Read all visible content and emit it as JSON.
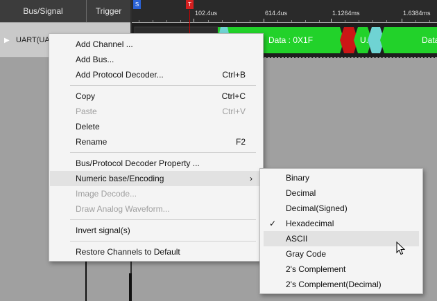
{
  "header": {
    "bus_signal": "Bus/Signal",
    "trigger": "Trigger",
    "ticks": [
      "102.4us",
      "614.4us",
      "1.1264ms",
      "1.6384ms"
    ],
    "marker_s": "S",
    "marker_t": "T"
  },
  "channel": {
    "name": "UART(UA",
    "frames": [
      "Data : 0X1F",
      "U.",
      "Data"
    ]
  },
  "colors": {
    "frame_green": "#22d22a",
    "frame_red": "#cc1616",
    "frame_cyan": "#6fd3d3",
    "menu_highlight": "#e2e2e2"
  },
  "context_menu": {
    "items": [
      {
        "label": "Add Channel ...",
        "shortcut": "",
        "disabled": false
      },
      {
        "label": "Add Bus...",
        "shortcut": "",
        "disabled": false
      },
      {
        "label": "Add Protocol Decoder...",
        "shortcut": "Ctrl+B",
        "disabled": false
      },
      {
        "label": "Copy",
        "shortcut": "Ctrl+C",
        "disabled": false
      },
      {
        "label": "Paste",
        "shortcut": "Ctrl+V",
        "disabled": true
      },
      {
        "label": "Delete",
        "shortcut": "",
        "disabled": false
      },
      {
        "label": "Rename",
        "shortcut": "F2",
        "disabled": false
      },
      {
        "label": "Bus/Protocol Decoder Property ...",
        "shortcut": "",
        "disabled": false
      },
      {
        "label": "Numeric base/Encoding",
        "shortcut": "",
        "disabled": false,
        "submenu": true,
        "highlighted": true
      },
      {
        "label": "Image Decode...",
        "shortcut": "",
        "disabled": true
      },
      {
        "label": "Draw Analog Waveform...",
        "shortcut": "",
        "disabled": true
      },
      {
        "label": "Invert signal(s)",
        "shortcut": "",
        "disabled": false
      },
      {
        "label": "Restore Channels to Default",
        "shortcut": "",
        "disabled": false
      }
    ],
    "submenu_arrow": "›"
  },
  "encoding_submenu": {
    "items": [
      {
        "label": "Binary",
        "checked": false
      },
      {
        "label": "Decimal",
        "checked": false
      },
      {
        "label": "Decimal(Signed)",
        "checked": false
      },
      {
        "label": "Hexadecimal",
        "checked": true
      },
      {
        "label": "ASCII",
        "checked": false,
        "hovered": true
      },
      {
        "label": "Gray Code",
        "checked": false
      },
      {
        "label": "2's Complement",
        "checked": false
      },
      {
        "label": "2's Complement(Decimal)",
        "checked": false
      }
    ],
    "check_glyph": "✓"
  }
}
